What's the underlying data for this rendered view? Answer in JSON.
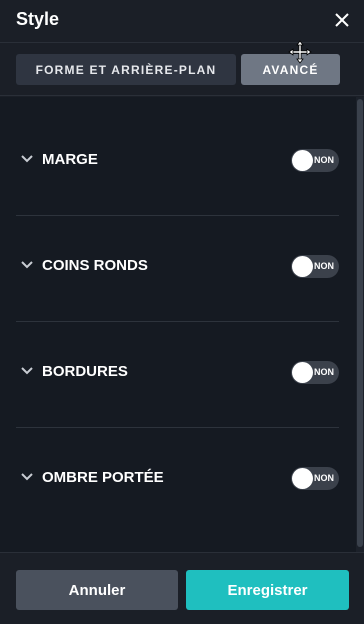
{
  "header": {
    "title": "Style",
    "close_icon": "close-icon"
  },
  "tabs": [
    {
      "label": "FORME ET ARRIÈRE-PLAN",
      "active": false
    },
    {
      "label": "AVANCÉ",
      "active": true
    }
  ],
  "sections": [
    {
      "label": "MARGE",
      "toggle_state": "NON",
      "icon": "chevron-down-icon"
    },
    {
      "label": "COINS RONDS",
      "toggle_state": "NON",
      "icon": "chevron-down-icon"
    },
    {
      "label": "BORDURES",
      "toggle_state": "NON",
      "icon": "chevron-down-icon"
    },
    {
      "label": "OMBRE PORTÉE",
      "toggle_state": "NON",
      "icon": "chevron-down-icon"
    }
  ],
  "footer": {
    "cancel_label": "Annuler",
    "save_label": "Enregistrer"
  },
  "colors": {
    "background": "#1b1f27",
    "panel": "#151a22",
    "accent": "#1fbfbf",
    "active_tab": "#6f7784"
  }
}
